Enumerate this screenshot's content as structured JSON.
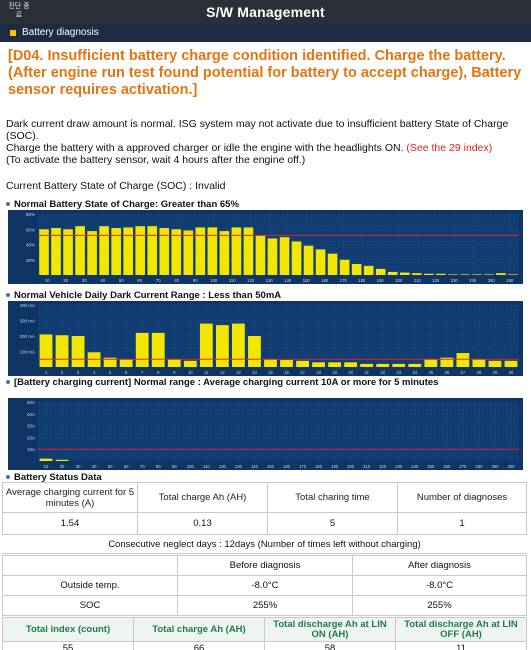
{
  "app": {
    "home_label": "진단 종료",
    "title": "S/W Management"
  },
  "section": {
    "label": "Battery diagnosis"
  },
  "headline": "[D04. Insufficient battery charge condition identified. Charge the battery. (After engine run test found potential for battery to accept charge), Battery sensor requires activation.]",
  "body": {
    "line1": "Dark current draw amount is normal. ISG system may not activate due to insufficient battery State of Charge (SOC).",
    "line2": "Charge the battery with a approved charger or idle the engine with the headlights ON.",
    "link": "(See the 29 index)",
    "line3": "(To activate the battery sensor, wait 4 hours after the engine off.)"
  },
  "soc_status": "Current Battery State of Charge (SOC) : Invalid",
  "charts": {
    "soc_title": "Normal Battery State of Charge: Greater than 65%",
    "dark_title": "Normal Vehicle Daily Dark Current Range : Less than 50mA",
    "charging_title": "[Battery charging current] Normal range : Average charging current 10A or more for 5 minutes"
  },
  "chart_data": [
    {
      "type": "bar",
      "title": "Normal Battery State of Charge: Greater than 65%",
      "ylim": [
        0,
        100
      ],
      "y_ticks": [
        "20%",
        "40%",
        "60%",
        "80%"
      ],
      "threshold": 65,
      "x_ticks": [
        "10",
        "20",
        "30",
        "40",
        "50",
        "60",
        "70",
        "80",
        "90",
        "100",
        "110",
        "120",
        "130",
        "140",
        "150",
        "160",
        "170",
        "180",
        "190",
        "200",
        "210",
        "220",
        "230",
        "240",
        "250",
        "260"
      ],
      "values": [
        75,
        77,
        75,
        80,
        72,
        80,
        77,
        78,
        80,
        80,
        77,
        75,
        73,
        78,
        78,
        72,
        78,
        78,
        65,
        60,
        62,
        55,
        48,
        42,
        35,
        25,
        18,
        15,
        10,
        5,
        4,
        3,
        2,
        2,
        1,
        1,
        1,
        1,
        3,
        1
      ],
      "colors": {
        "bar": "#f2e600",
        "background": "#0f3566",
        "grid": "#2b5489",
        "threshold": "#e0242b"
      }
    },
    {
      "type": "bar",
      "title": "Normal Vehicle Daily Dark Current Range : Less than 50mA",
      "ylim": [
        0,
        400
      ],
      "y_ticks": [
        "100 mA",
        "200 mA",
        "300 mA",
        "400 mA"
      ],
      "threshold": 50,
      "x_ticks": [
        "1",
        "2",
        "3",
        "4",
        "5",
        "6",
        "7",
        "8",
        "9",
        "10",
        "11",
        "12",
        "13",
        "14",
        "15",
        "16",
        "17",
        "18",
        "19",
        "20",
        "21",
        "22",
        "23",
        "24",
        "25",
        "26",
        "27",
        "28",
        "29",
        "30"
      ],
      "values": [
        210,
        205,
        200,
        95,
        60,
        50,
        220,
        220,
        50,
        40,
        280,
        270,
        280,
        200,
        50,
        45,
        40,
        30,
        30,
        30,
        20,
        20,
        20,
        20,
        50,
        60,
        90,
        50,
        40,
        40
      ],
      "colors": {
        "bar": "#f2e600",
        "background": "#0f3566",
        "grid": "#2b5489",
        "threshold": "#e0242b"
      }
    },
    {
      "type": "bar",
      "title": "[Battery charging current] Normal range : Average charging current 10A or more for 5 minutes",
      "ylim": [
        0,
        50
      ],
      "y_ticks": [
        "10A",
        "20A",
        "30A",
        "40A",
        "50A"
      ],
      "threshold": 10,
      "x_ticks": [
        "10",
        "20",
        "30",
        "40",
        "50",
        "60",
        "70",
        "80",
        "90",
        "100",
        "110",
        "120",
        "130",
        "140",
        "150",
        "160",
        "170",
        "180",
        "190",
        "200",
        "210",
        "220",
        "230",
        "240",
        "250",
        "260",
        "270",
        "280",
        "290",
        "300"
      ],
      "values": [
        2,
        1,
        0,
        0,
        0,
        0,
        0,
        0,
        0,
        0,
        0,
        0,
        0,
        0,
        0,
        0,
        0,
        0,
        0,
        0,
        0,
        0,
        0,
        0,
        0,
        0,
        0,
        0,
        0,
        0
      ],
      "colors": {
        "bar": "#f2e600",
        "background": "#0f3566",
        "grid": "#2b5489",
        "threshold": "#e0242b"
      }
    }
  ],
  "status": {
    "title": "Battery Status Data",
    "headers": [
      "Average charging current for 5 minutes (A)",
      "Total charge Ah (AH)",
      "Total charing time",
      "Number of diagnoses"
    ],
    "values": [
      "1.54",
      "0.13",
      "5",
      "1"
    ],
    "neglect": "Consecutive neglect days : 12days (Number of times left without charging)",
    "compare_headers": [
      "",
      "Before diagnosis",
      "After diagnosis"
    ],
    "outside_temp": {
      "label": "Outside temp.",
      "before": "-8.0°C",
      "after": "-8.0°C"
    },
    "soc": {
      "label": "SOC",
      "before": "255%",
      "after": "255%"
    },
    "index_headers": [
      "Total index (count)",
      "Total charge Ah (AH)",
      "Total discharge Ah at LIN ON (AH)",
      "Total discharge Ah at LIN OFF (AH)"
    ],
    "index_values": [
      "55",
      "66",
      "58",
      "11"
    ]
  }
}
